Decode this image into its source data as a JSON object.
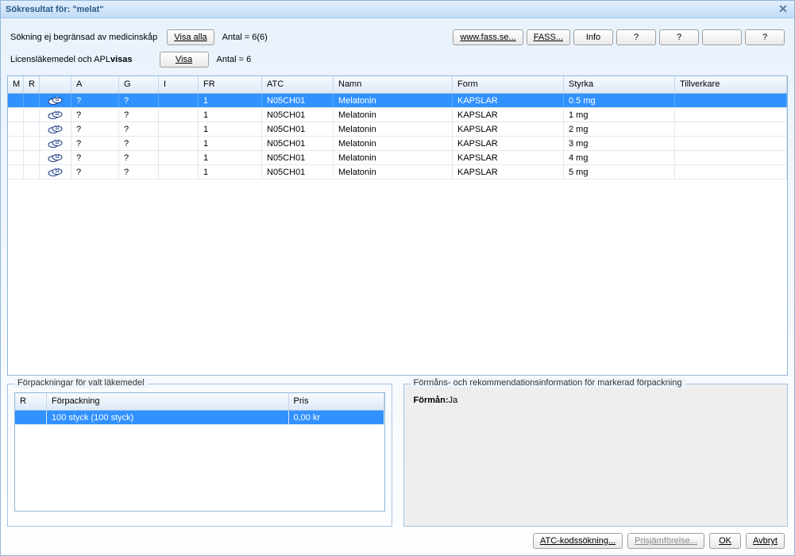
{
  "title": "Sökresultat för: \"melat\"",
  "filter": {
    "line1_label": "Sökning ej begränsad av medicinskåp",
    "show_all_btn": "Visa alla",
    "count1": "Antal = 6(6)",
    "line2_prefix": "Licensläkemedel och APL ",
    "line2_strong": "visas",
    "show_btn": "Visa",
    "count2": "Antal = 6"
  },
  "top_buttons": {
    "fass_www": "www.fass.se...",
    "fass": "FASS...",
    "info": "Info",
    "q1": "?",
    "q2": "?",
    "blank": "",
    "q3": "?"
  },
  "grid": {
    "headers": {
      "m": "M",
      "r": "R",
      "icon": "",
      "a": "A",
      "g": "G",
      "i": "I",
      "fr": "FR",
      "atc": "ATC",
      "namn": "Namn",
      "form": "Form",
      "styrka": "Styrka",
      "tillverkare": "Tillverkare"
    },
    "rows": [
      {
        "selected": true,
        "a": "?",
        "g": "?",
        "i": "",
        "fr": "1",
        "atc": "N05CH01",
        "namn": "Melatonin",
        "form": "KAPSLAR",
        "styrka": "0.5 mg",
        "tillv": ""
      },
      {
        "selected": false,
        "a": "?",
        "g": "?",
        "i": "",
        "fr": "1",
        "atc": "N05CH01",
        "namn": "Melatonin",
        "form": "KAPSLAR",
        "styrka": "1 mg",
        "tillv": ""
      },
      {
        "selected": false,
        "a": "?",
        "g": "?",
        "i": "",
        "fr": "1",
        "atc": "N05CH01",
        "namn": "Melatonin",
        "form": "KAPSLAR",
        "styrka": "2 mg",
        "tillv": ""
      },
      {
        "selected": false,
        "a": "?",
        "g": "?",
        "i": "",
        "fr": "1",
        "atc": "N05CH01",
        "namn": "Melatonin",
        "form": "KAPSLAR",
        "styrka": "3 mg",
        "tillv": ""
      },
      {
        "selected": false,
        "a": "?",
        "g": "?",
        "i": "",
        "fr": "1",
        "atc": "N05CH01",
        "namn": "Melatonin",
        "form": "KAPSLAR",
        "styrka": "4 mg",
        "tillv": ""
      },
      {
        "selected": false,
        "a": "?",
        "g": "?",
        "i": "",
        "fr": "1",
        "atc": "N05CH01",
        "namn": "Melatonin",
        "form": "KAPSLAR",
        "styrka": "5 mg",
        "tillv": ""
      }
    ]
  },
  "packages": {
    "legend": "Förpackningar för valt läkemedel",
    "headers": {
      "r": "R",
      "pack": "Förpackning",
      "price": "Pris"
    },
    "rows": [
      {
        "selected": true,
        "r": "",
        "pack": "100 styck (100 styck)",
        "price": "0,00 kr"
      }
    ]
  },
  "benefit": {
    "legend": "Förmåns- och rekommendationsinformation för markerad förpackning",
    "label": "Förmån:",
    "value": "Ja"
  },
  "footer": {
    "atc": "ATC-kodssökning...",
    "compare": "Prisjämförelse...",
    "ok": "OK",
    "cancel": "Avbryt"
  }
}
